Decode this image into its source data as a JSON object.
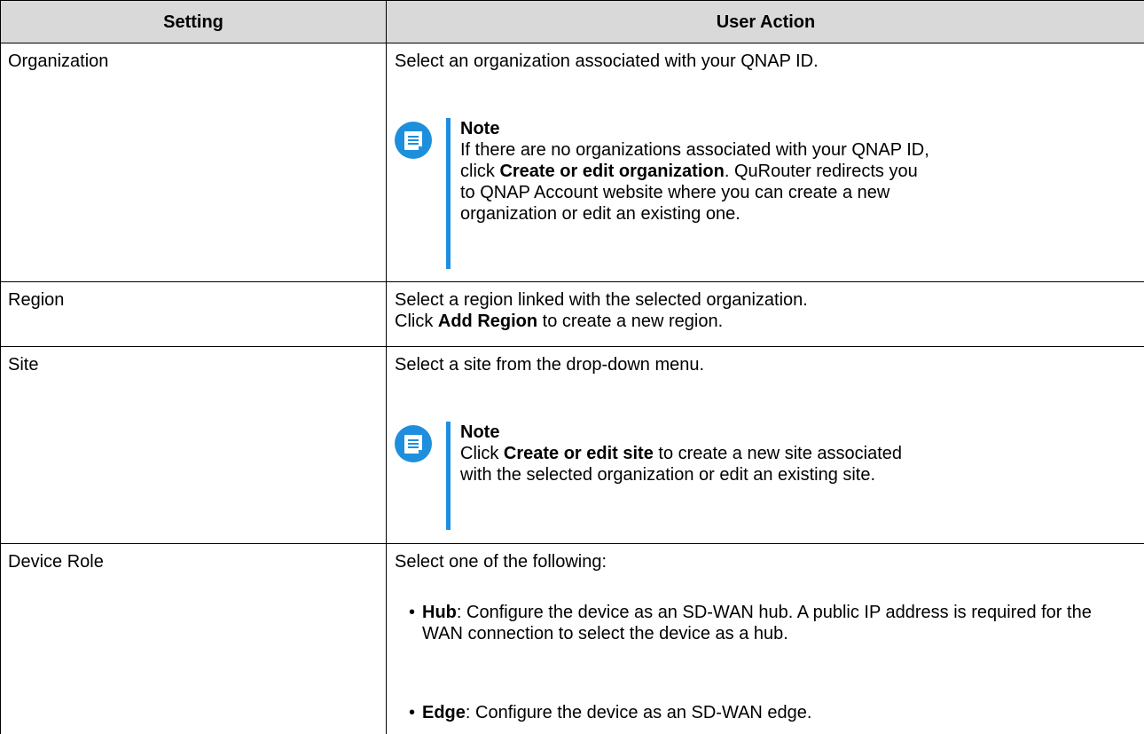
{
  "header": {
    "col1": "Setting",
    "col2": "User Action"
  },
  "rows": [
    {
      "setting": "Organization",
      "action": "Select an organization associated with your QNAP ID.",
      "note": {
        "title": "Note",
        "pre": "If there are no organizations associated with your QNAP ID, click ",
        "bold": "Create or edit organization",
        "post": ". QuRouter redirects you to QNAP Account website where you can create a new organization or edit an existing one."
      }
    },
    {
      "setting": "Region",
      "action": "Select a region linked with the selected organization.",
      "action2_pre": "Click ",
      "action2_bold": "Add Region",
      "action2_post": " to create a new region."
    },
    {
      "setting": "Site",
      "action": "Select a site from the drop-down menu.",
      "note": {
        "title": "Note",
        "pre": "Click ",
        "bold": "Create or edit site",
        "post": " to create a new site associated with the selected organization or edit an existing site."
      }
    },
    {
      "setting": "Device Role",
      "action": "Select one of the following:",
      "bullets": [
        {
          "bold": "Hub",
          "text": ": Configure the device as an SD-WAN hub. A public IP address is required for the WAN connection to select the device as a hub."
        },
        {
          "bold": "Edge",
          "text": ": Configure the device as an SD-WAN edge."
        }
      ]
    }
  ],
  "icons": {
    "note_icon": "note-speech-bubble-icon",
    "note_color": "#1d8fdd"
  }
}
